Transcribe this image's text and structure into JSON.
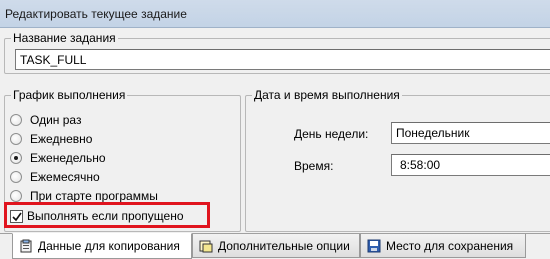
{
  "window": {
    "title": "Редактировать текущее задание"
  },
  "task_name": {
    "label": "Название задания",
    "value": "TASK_FULL"
  },
  "schedule": {
    "label": "График выполнения",
    "options": [
      "Один раз",
      "Ежедневно",
      "Еженедельно",
      "Ежемесячно",
      "При старте программы"
    ],
    "selected": "Еженедельно",
    "run_if_missed": {
      "label": "Выполнять если пропущено",
      "checked": true
    }
  },
  "datetime": {
    "label": "Дата и время выполнения",
    "weekday_label": "День недели:",
    "weekday_value": "Понедельник",
    "time_label": "Время:",
    "time_value": "8:58:00"
  },
  "tabs": [
    {
      "label": "Данные для копирования",
      "icon": "clipboard-icon",
      "active": true
    },
    {
      "label": "Дополнительные опции",
      "icon": "options-icon",
      "active": false
    },
    {
      "label": "Место для сохранения",
      "icon": "save-location-icon",
      "active": false
    }
  ],
  "colors": {
    "highlight": "#e0141e"
  }
}
